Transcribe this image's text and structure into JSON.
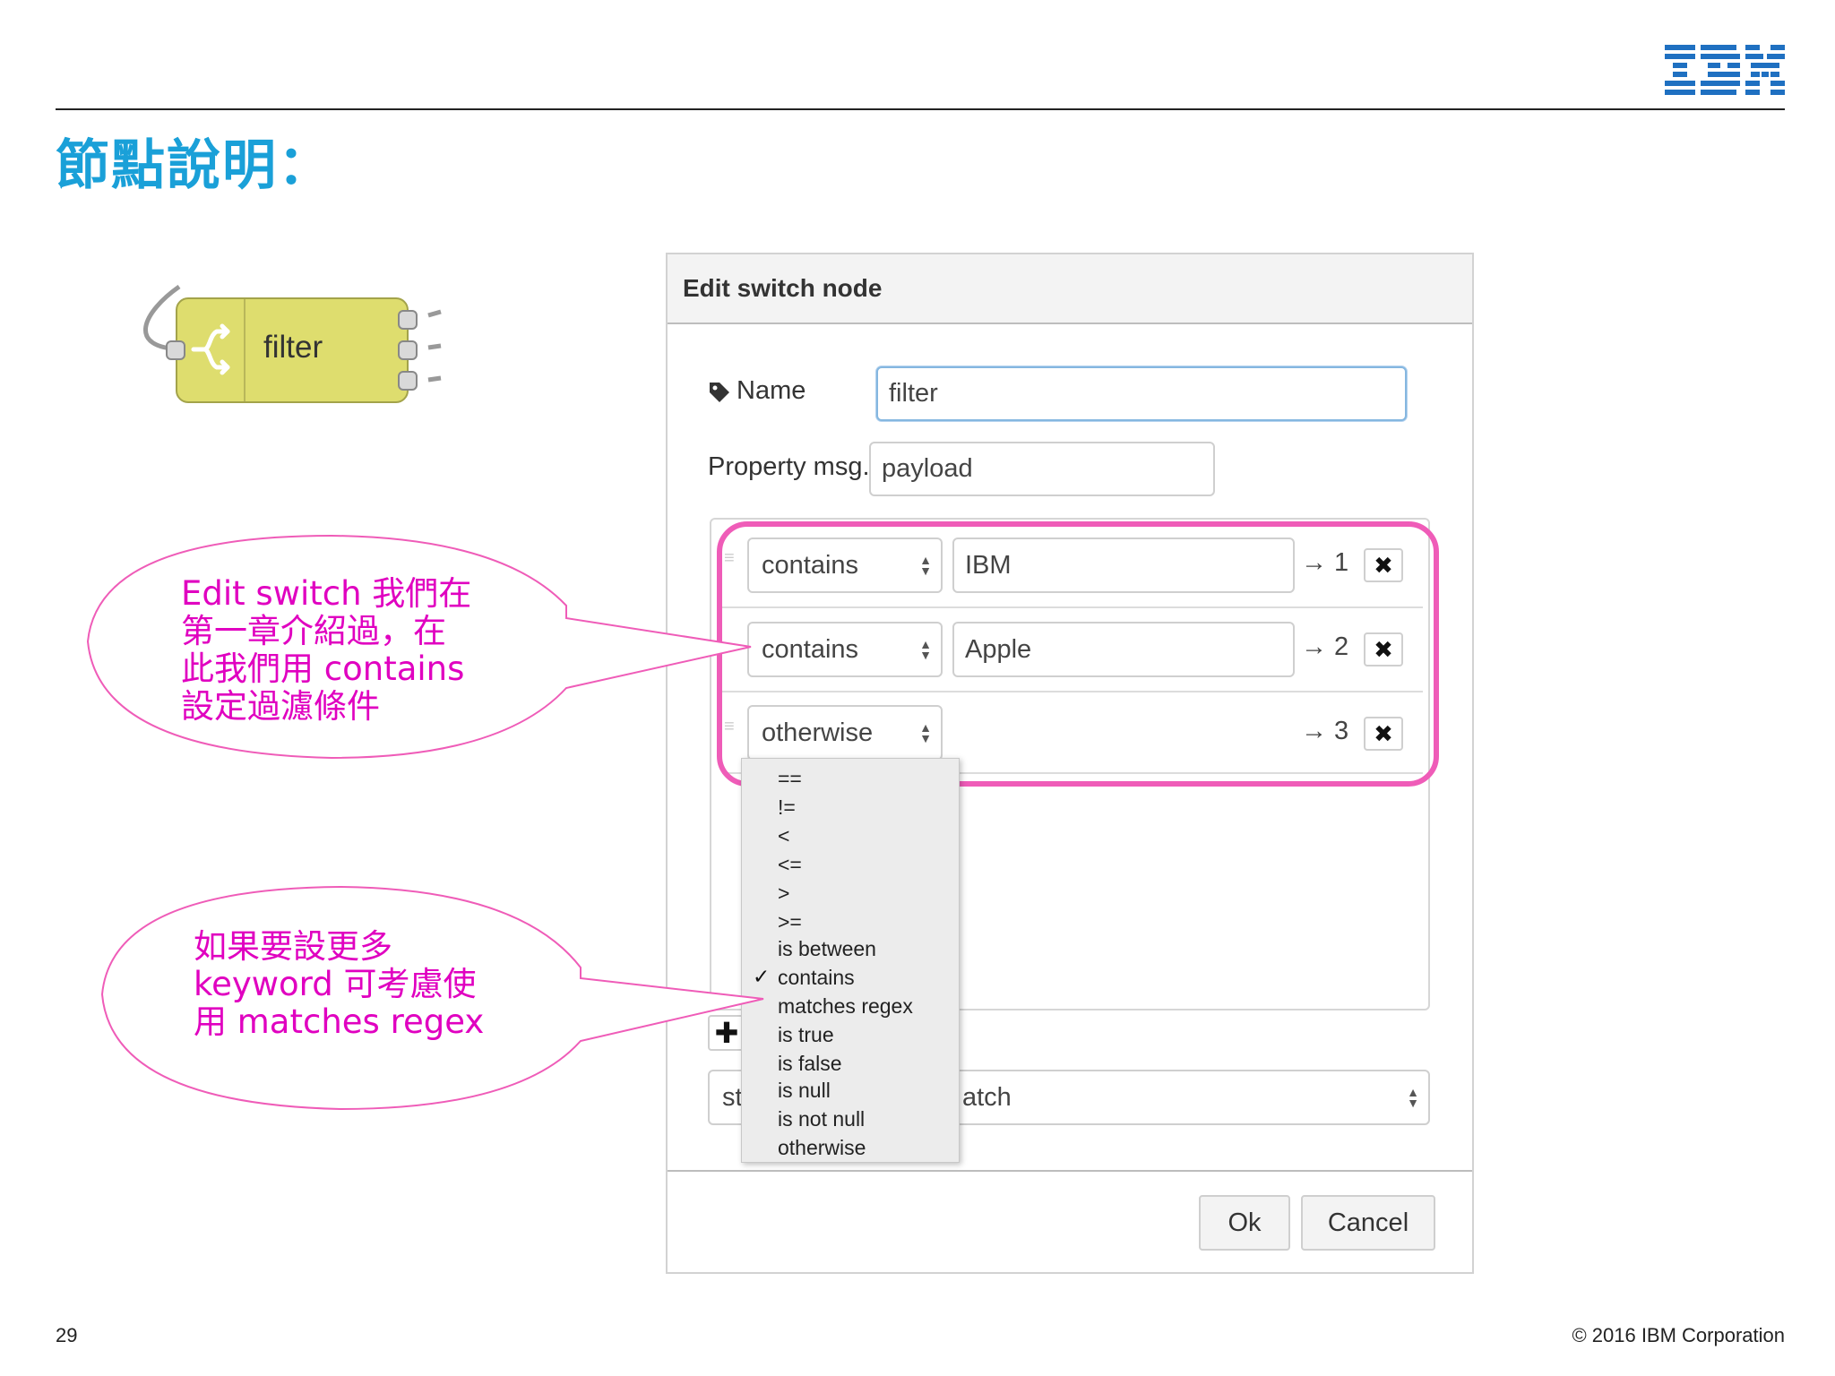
{
  "slide": {
    "title": "節點說明：",
    "page_number": "29",
    "copyright": "© 2016 IBM Corporation",
    "logo_text": "IBM",
    "accent_color": "#1aa0d8"
  },
  "node": {
    "label": "filter",
    "color": "#dedd6e",
    "icon": "switch-icon"
  },
  "dialog": {
    "title": "Edit switch node",
    "name_label": "Name",
    "name_value": "filter",
    "property_label": "Property msg.",
    "property_value": "payload",
    "rules": [
      {
        "operator": "contains",
        "value": "IBM",
        "output": "→ 1",
        "delete_icon": "✖"
      },
      {
        "operator": "contains",
        "value": "Apple",
        "output": "→ 2",
        "delete_icon": "✖"
      },
      {
        "operator": "otherwise",
        "value": "",
        "output": "→ 3",
        "delete_icon": "✖"
      }
    ],
    "add_button": "✚",
    "bottom_select_prefix": "st",
    "bottom_select_suffix": "atch",
    "ok_label": "Ok",
    "cancel_label": "Cancel"
  },
  "dropdown": {
    "options": [
      "==",
      "!=",
      "<",
      "<=",
      ">",
      ">=",
      "is between",
      "contains",
      "matches regex",
      "is true",
      "is false",
      "is null",
      "is not null",
      "otherwise"
    ],
    "selected": "contains",
    "check_mark": "✓"
  },
  "callouts": [
    {
      "lines": [
        "Edit  switch  我們在",
        "第一章介紹過，在",
        "此我們用  contains",
        "設定過濾條件"
      ]
    },
    {
      "lines": [
        "如果要設更多",
        "keyword  可考慮使",
        "用 matches regex"
      ]
    }
  ],
  "highlight_color": "#ef5cb8",
  "callout_color": "#e000c0"
}
